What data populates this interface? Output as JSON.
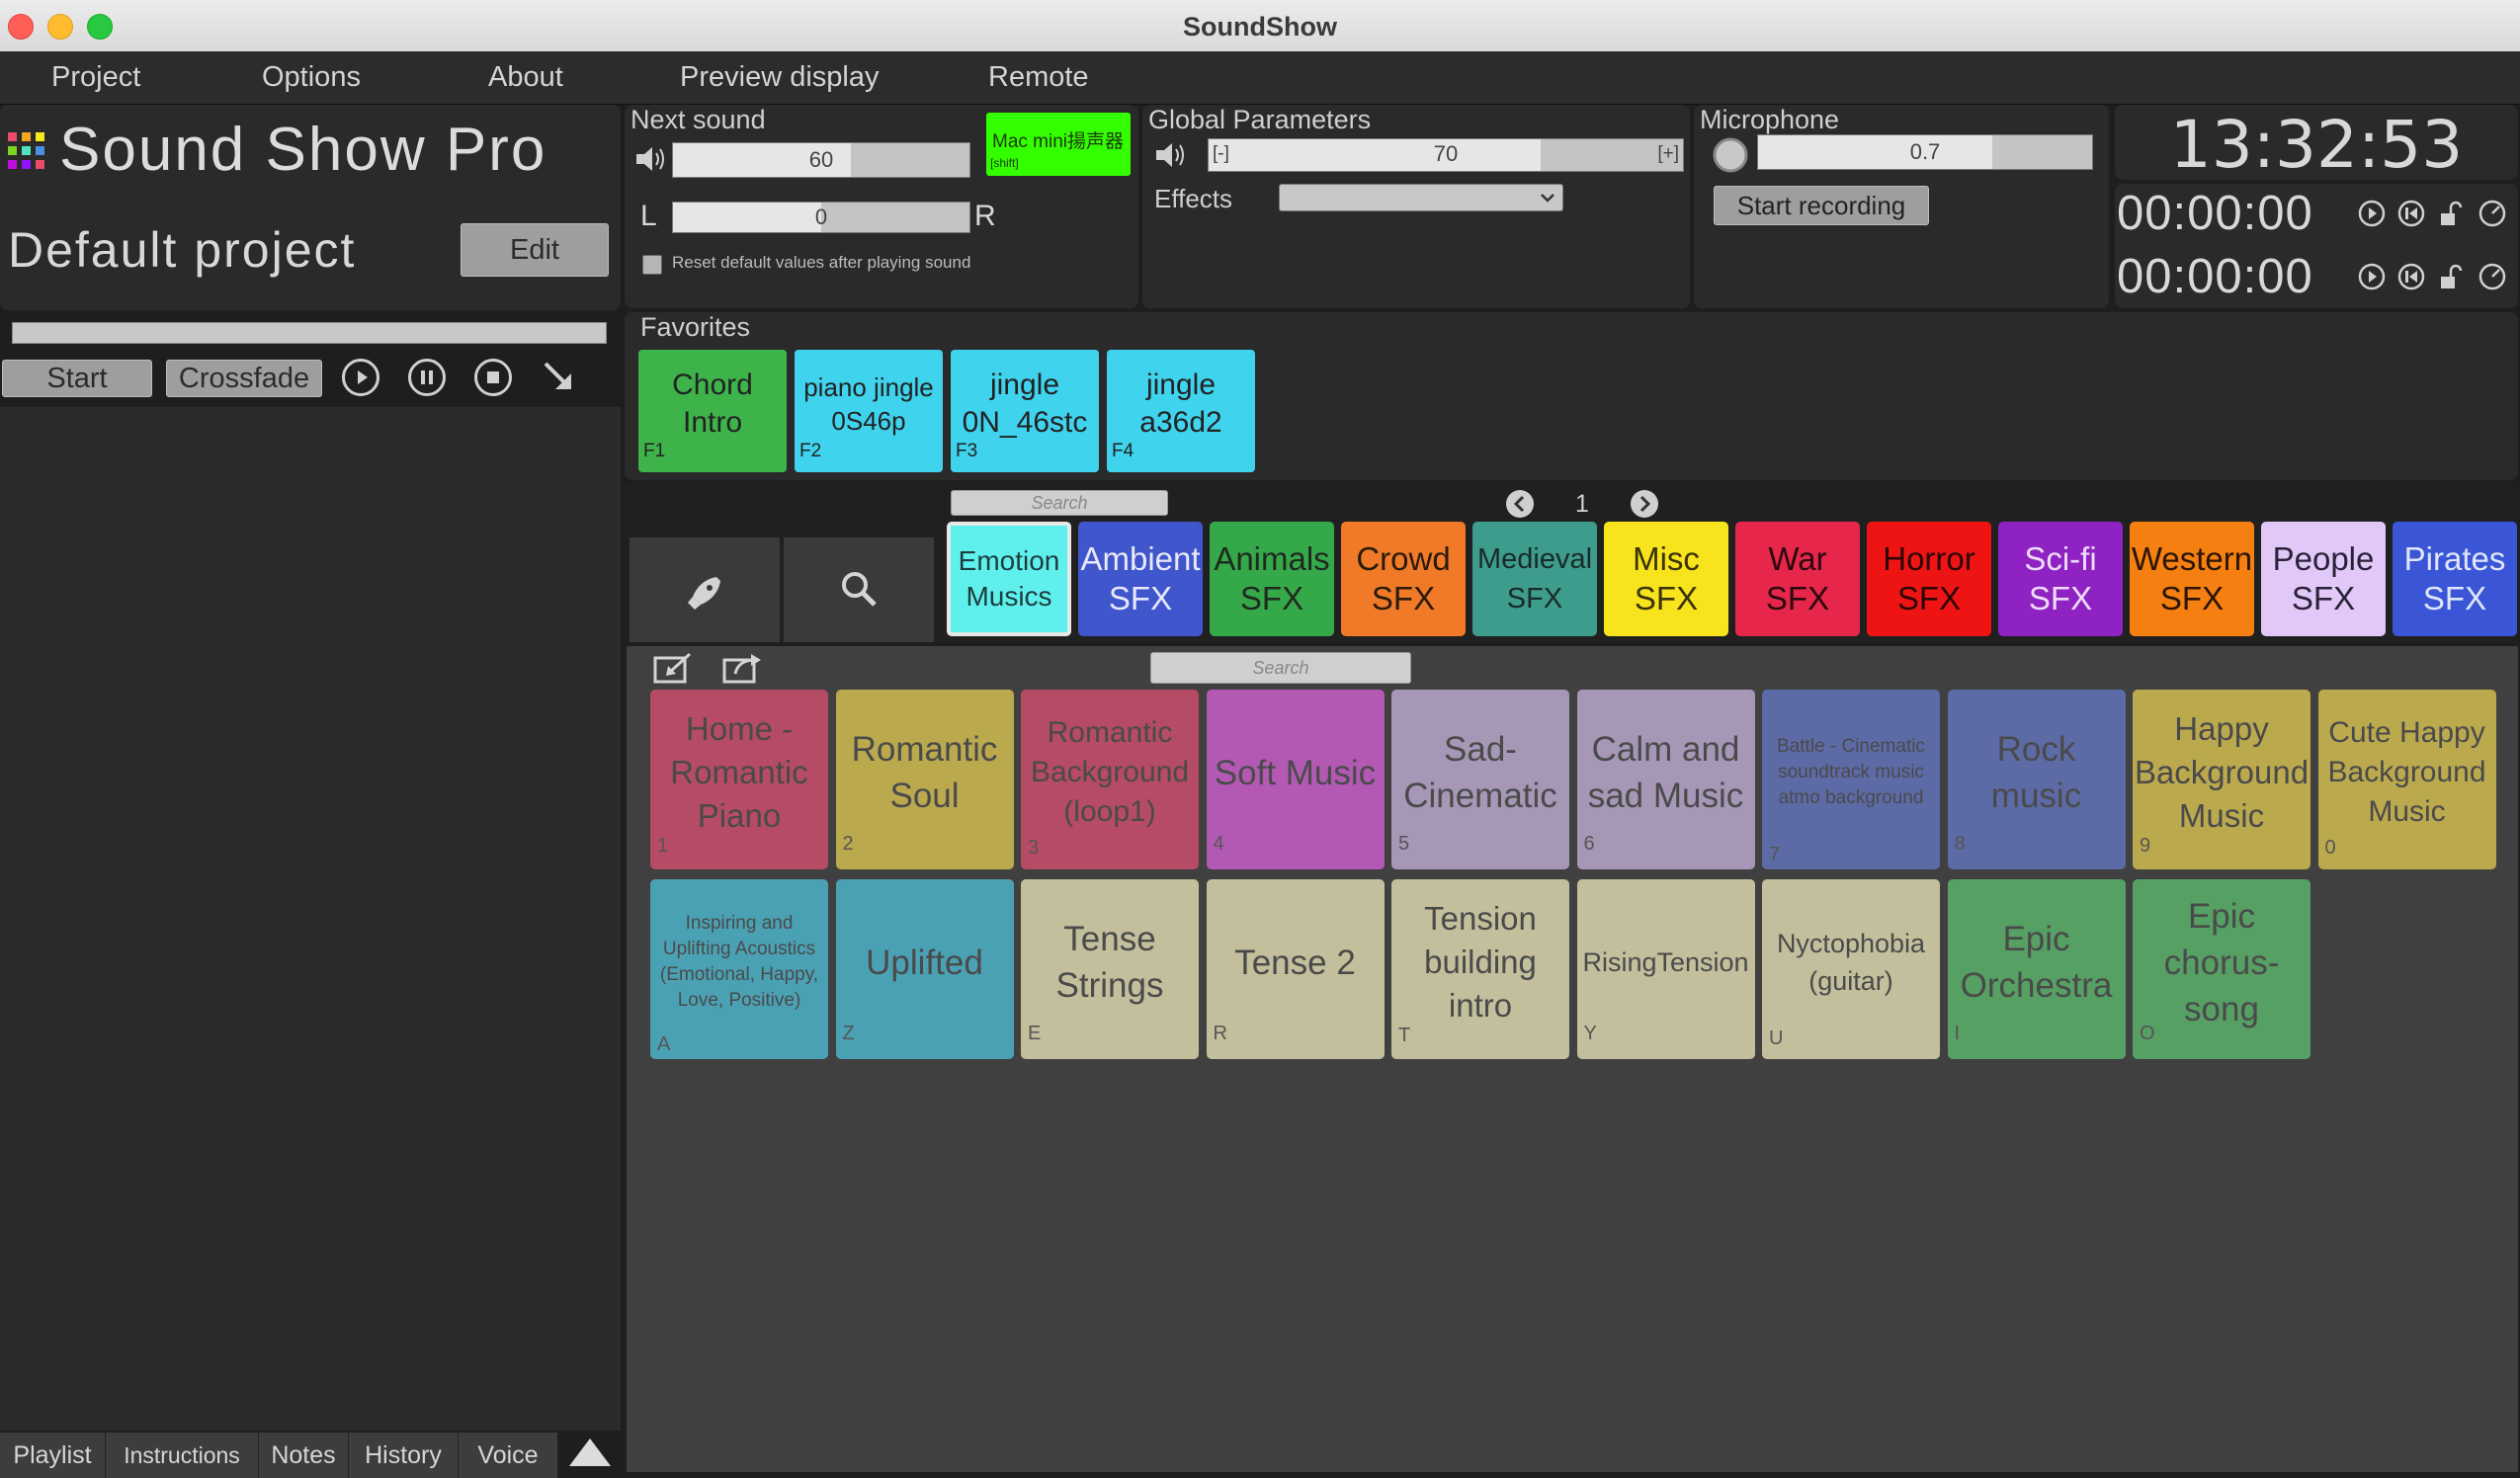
{
  "window": {
    "title": "SoundShow"
  },
  "menu": [
    "Project",
    "Options",
    "About",
    "Preview display",
    "Remote"
  ],
  "app": {
    "logo_text": "Sound Show Pro",
    "project_name": "Default project",
    "edit_label": "Edit"
  },
  "transport": {
    "start_label": "Start",
    "crossfade_label": "Crossfade"
  },
  "next_sound": {
    "label": "Next sound",
    "volume_value": "60",
    "volume_fraction": 0.6,
    "balance_value": "0",
    "balance_fraction": 0.5,
    "left_label": "L",
    "right_label": "R",
    "device_line1": "Mac mini揚声器",
    "device_line2": "[shift]",
    "reset_label": "Reset default values after playing sound"
  },
  "global": {
    "label": "Global Parameters",
    "minus_label": "[-]",
    "plus_label": "[+]",
    "volume_value": "70",
    "volume_fraction": 0.7,
    "effects_label": "Effects"
  },
  "microphone": {
    "label": "Microphone",
    "level_value": "0.7",
    "level_fraction": 0.7,
    "record_label": "Start recording"
  },
  "clock": {
    "time": "13:32:53",
    "timer1": "00:00:00",
    "timer2": "00:00:00"
  },
  "favorites": {
    "label": "Favorites",
    "items": [
      {
        "name": "Chord Intro",
        "key": "F1",
        "color": "#3db34a"
      },
      {
        "name": "piano jingle 0S46p",
        "key": "F2",
        "color": "#3fd3ee"
      },
      {
        "name": "jingle 0N_46stc",
        "key": "F3",
        "color": "#3fd3ee"
      },
      {
        "name": "jingle a36d2",
        "key": "F4",
        "color": "#3fd3ee"
      }
    ]
  },
  "browser": {
    "search_placeholder": "Search",
    "page": "1",
    "tile_search_placeholder": "Search"
  },
  "categories": [
    {
      "name": "Emotion Musics",
      "color": "#5ff0ee",
      "text": "#1d3d3d",
      "selected": true
    },
    {
      "name": "Ambient SFX",
      "color": "#3f56cc",
      "text": "#e8e8f8"
    },
    {
      "name": "Animals SFX",
      "color": "#35a94a",
      "text": "#1f2a1f"
    },
    {
      "name": "Crowd SFX",
      "color": "#f07a28",
      "text": "#2a1a0a"
    },
    {
      "name": "Medieval SFX",
      "color": "#3d9c8c",
      "text": "#1a2a28"
    },
    {
      "name": "Misc SFX",
      "color": "#f8e41c",
      "text": "#3a3208"
    },
    {
      "name": "War SFX",
      "color": "#e6264a",
      "text": "#2a0a10"
    },
    {
      "name": "Horror SFX",
      "color": "#ef1414",
      "text": "#2a0606"
    },
    {
      "name": "Sci-fi SFX",
      "color": "#8e22c2",
      "text": "#eedcf8"
    },
    {
      "name": "Western SFX",
      "color": "#f57f10",
      "text": "#2a1506"
    },
    {
      "name": "People SFX",
      "color": "#e2c8f8",
      "text": "#2a2238"
    },
    {
      "name": "Pirates SFX",
      "color": "#3a56d6",
      "text": "#e0e6fa"
    }
  ],
  "sounds": [
    {
      "name": "Home - Romantic Piano",
      "key": "1",
      "color": "#b54b64"
    },
    {
      "name": "Romantic Soul",
      "key": "2",
      "color": "#bba94e"
    },
    {
      "name": "Romantic Background (loop1)",
      "key": "3",
      "color": "#b54b64"
    },
    {
      "name": "Soft Music",
      "key": "4",
      "color": "#b359b4"
    },
    {
      "name": "Sad-Cinematic",
      "key": "5",
      "color": "#a697b6"
    },
    {
      "name": "Calm and sad Music",
      "key": "6",
      "color": "#a697b6"
    },
    {
      "name": "Battle - Cinematic soundtrack music atmo background",
      "key": "7",
      "color": "#5c6aa6"
    },
    {
      "name": "Rock music",
      "key": "8",
      "color": "#5c6aa6"
    },
    {
      "name": "Happy Background Music",
      "key": "9",
      "color": "#bba94e"
    },
    {
      "name": "Cute Happy Background Music",
      "key": "0",
      "color": "#bba94e"
    },
    {
      "name": "Inspiring and Uplifting Acoustics (Emotional, Happy, Love, Positive)",
      "key": "A",
      "color": "#4ba1b4"
    },
    {
      "name": "Uplifted",
      "key": "Z",
      "color": "#4ba1b4"
    },
    {
      "name": "Tense Strings",
      "key": "E",
      "color": "#c3bf9c"
    },
    {
      "name": "Tense 2",
      "key": "R",
      "color": "#c3bf9c"
    },
    {
      "name": "Tension building intro",
      "key": "T",
      "color": "#c3bf9c"
    },
    {
      "name": "RisingTension",
      "key": "Y",
      "color": "#c3bf9c"
    },
    {
      "name": "Nyctophobia (guitar)",
      "key": "U",
      "color": "#c3bf9c"
    },
    {
      "name": "Epic Orchestra",
      "key": "I",
      "color": "#56a064"
    },
    {
      "name": "Epic chorus-song",
      "key": "O",
      "color": "#56a064"
    }
  ],
  "bottom_tabs": [
    "Playlist",
    "Instructions",
    "Notes",
    "History",
    "Voice"
  ]
}
